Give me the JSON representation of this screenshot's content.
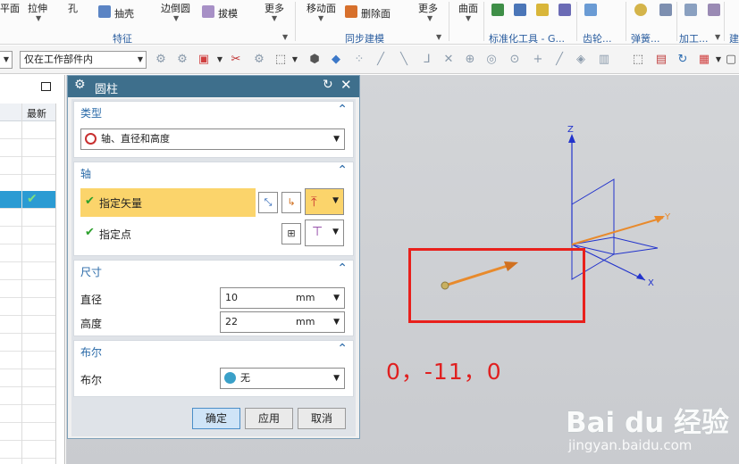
{
  "ribbon": {
    "items": [
      {
        "label": "平面"
      },
      {
        "label": "拉伸"
      },
      {
        "label": "孔"
      },
      {
        "label": "抽壳"
      },
      {
        "label": "边倒圆"
      },
      {
        "label": "拔模"
      },
      {
        "label": "更多"
      },
      {
        "label": "移动面"
      },
      {
        "label": "删除面"
      },
      {
        "label": "更多"
      },
      {
        "label": "曲面"
      }
    ],
    "groups": [
      "特征",
      "同步建模",
      "标准化工具 - G...",
      "齿轮...",
      "弹簧...",
      "加工...",
      "建"
    ]
  },
  "toolbar": {
    "scope_value": "仅在工作部件内"
  },
  "navigator": {
    "column_header": "最新"
  },
  "dialog": {
    "title": "圆柱",
    "type_section": {
      "title": "类型",
      "value": "轴、直径和高度"
    },
    "axis_section": {
      "title": "轴",
      "vector_label": "指定矢量",
      "point_label": "指定点"
    },
    "size_section": {
      "title": "尺寸",
      "diameter_label": "直径",
      "diameter_value": "10",
      "diameter_unit": "mm",
      "height_label": "高度",
      "height_value": "22",
      "height_unit": "mm"
    },
    "boolean_section": {
      "title": "布尔",
      "label": "布尔",
      "value": "无"
    },
    "buttons": {
      "ok": "确定",
      "apply": "应用",
      "cancel": "取消"
    }
  },
  "viewport": {
    "axis_x": "X",
    "axis_y": "Y",
    "axis_z": "Z",
    "annotation": "0，-11，0"
  },
  "watermark": {
    "logo": "Bai du 经验",
    "url": "jingyan.baidu.com"
  },
  "colors": {
    "accent": "#3e6f8c",
    "highlight": "#fbd46b",
    "annotation": "#e02020",
    "vector": "#e88a2c",
    "csys": "#2233cc"
  }
}
